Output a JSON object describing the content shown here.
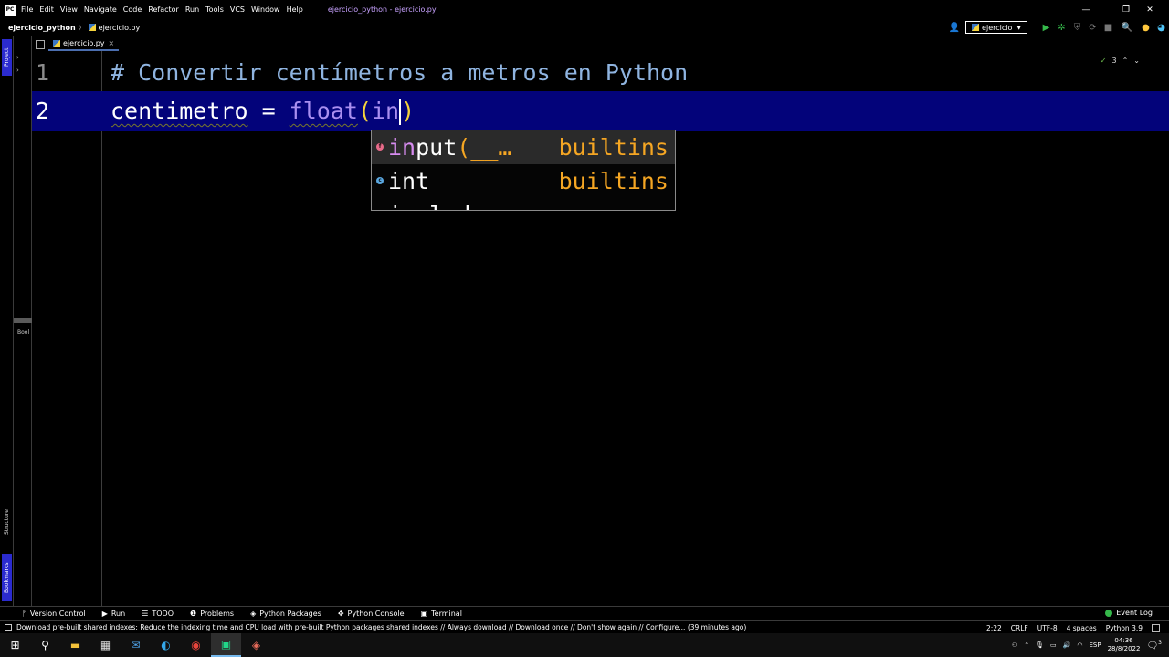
{
  "app": {
    "logo_text": "PC",
    "window_title": "ejercicio_python - ejercicio.py",
    "menu": [
      "File",
      "Edit",
      "View",
      "Navigate",
      "Code",
      "Refactor",
      "Run",
      "Tools",
      "VCS",
      "Window",
      "Help"
    ],
    "window_controls": {
      "minimize": "—",
      "restore": "❐",
      "close": "✕"
    }
  },
  "navbar": {
    "project": "ejercicio_python",
    "file": "ejercicio.py",
    "run_config": "ejercicio",
    "run_config_arrow": "▼"
  },
  "left_strip": {
    "project_tab": "Project",
    "structure_tab": "Structure",
    "bookmarks_tab": "Bookmarks",
    "mini_label": "Bool"
  },
  "editor_tab": {
    "label": "ejercicio.py",
    "close": "×"
  },
  "inspection": {
    "count": "3",
    "up": "⌃",
    "down": "⌄"
  },
  "code": {
    "lines": [
      {
        "number": "1",
        "comment": "# Convertir centímetros a metros en Python"
      },
      {
        "number": "2",
        "ident": "centimetro",
        "op": " = ",
        "func": "float",
        "open": "(",
        "typed": "in",
        "close": ")"
      }
    ]
  },
  "completion": {
    "items": [
      {
        "kind": "f",
        "match": "in",
        "rest": "put",
        "signature": "(__…",
        "source": "builtins",
        "selected": true
      },
      {
        "kind": "c",
        "match": "in",
        "rest": "t",
        "signature": "",
        "source": "builtins",
        "selected": false
      },
      {
        "kind": "f",
        "match": "in",
        "rest": "clude",
        "signature": "",
        "source": "",
        "selected": false
      }
    ]
  },
  "tool_windows": [
    {
      "label": "Version Control",
      "icon": "ᚠ"
    },
    {
      "label": "Run",
      "icon": "▶"
    },
    {
      "label": "TODO",
      "icon": "☰"
    },
    {
      "label": "Problems",
      "icon": "❶"
    },
    {
      "label": "Python Packages",
      "icon": "◈"
    },
    {
      "label": "Python Console",
      "icon": "✥"
    },
    {
      "label": "Terminal",
      "icon": "▣"
    }
  ],
  "event_log": "Event Log",
  "status": {
    "message": "Download pre-built shared indexes: Reduce the indexing time and CPU load with pre-built Python packages shared indexes // Always download // Download once // Don't show again // Configure... (39 minutes ago)",
    "position": "2:22",
    "line_sep": "CRLF",
    "encoding": "UTF-8",
    "indent": "4 spaces",
    "interpreter": "Python 3.9"
  },
  "taskbar": {
    "lang": "ESP",
    "time": "04:36",
    "date": "28/8/2022",
    "notifications": "3"
  }
}
